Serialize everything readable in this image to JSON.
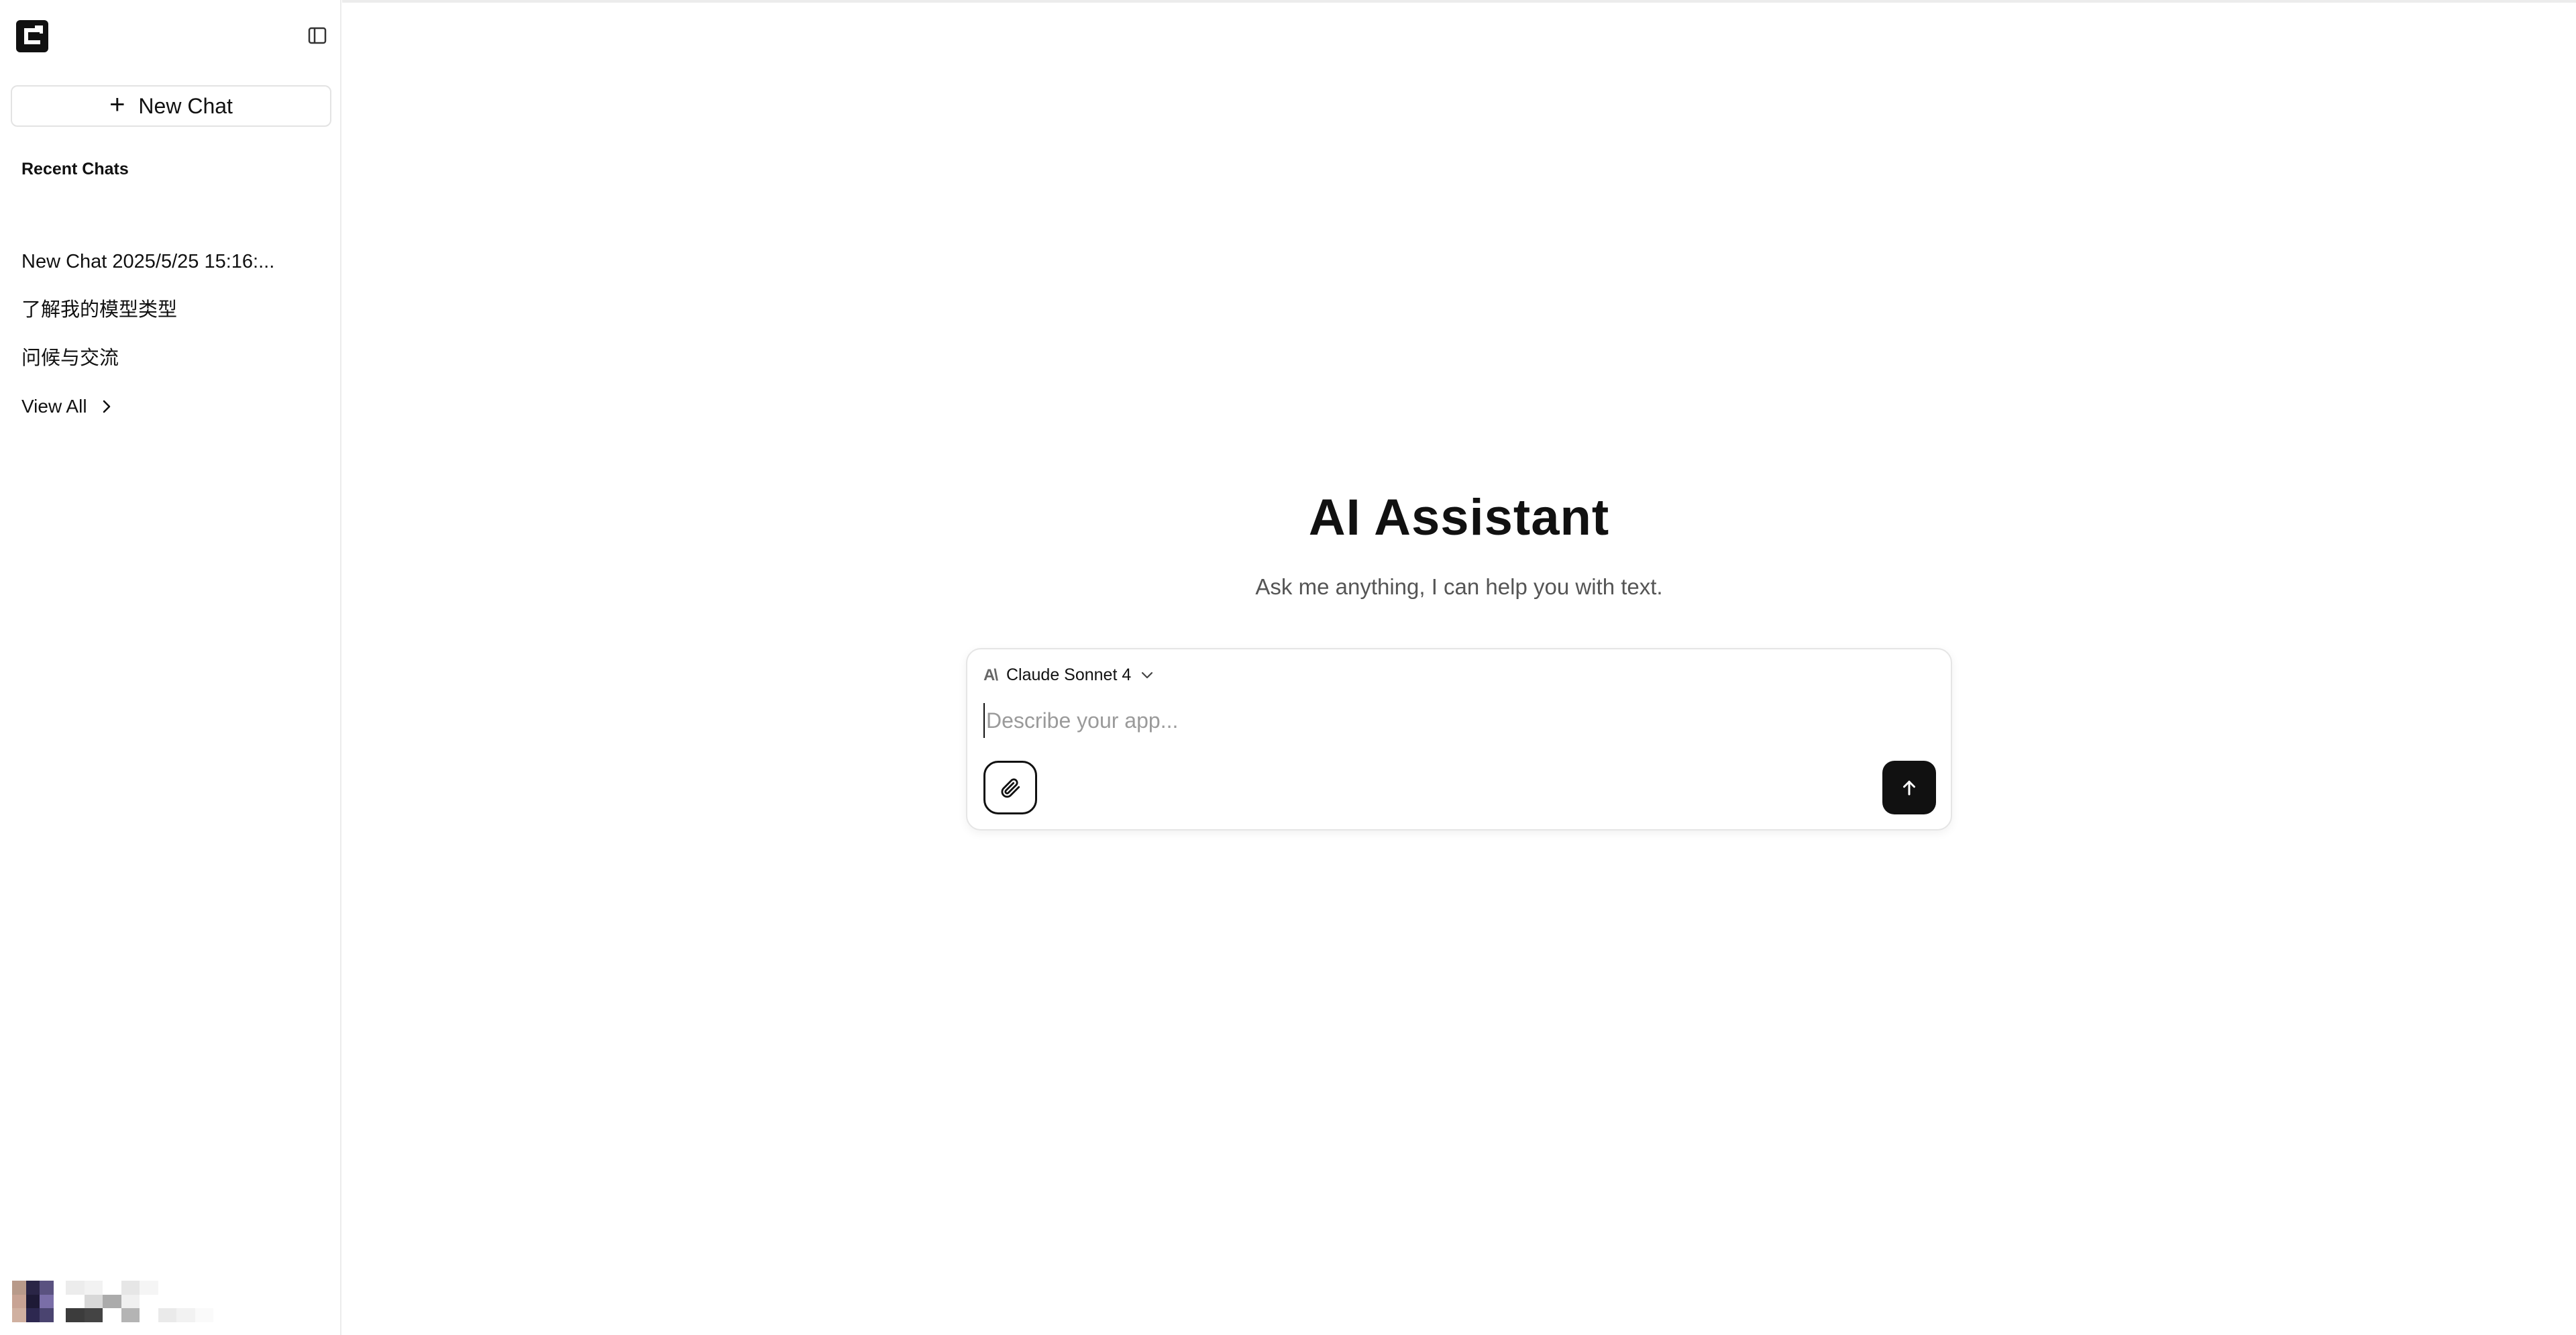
{
  "app": {
    "title": "AI Assistant",
    "subtitle": "Ask me anything, I can help you with text."
  },
  "sidebar": {
    "new_chat_label": "New Chat",
    "recent_title": "Recent Chats",
    "chats": [
      {
        "label": "New Chat 2025/5/25 15:16:..."
      },
      {
        "label": "了解我的模型类型"
      },
      {
        "label": "问候与交流"
      }
    ],
    "view_all_label": "View All",
    "icons": {
      "logo": "app-logo-icon",
      "collapse": "sidebar-toggle-icon",
      "plus": "plus-icon",
      "view_all": "chevron-right-icon"
    }
  },
  "composer": {
    "model_name": "Claude Sonnet 4",
    "placeholder": "Describe your app...",
    "value": "",
    "icons": {
      "model": "anthropic-icon",
      "dropdown": "chevron-down-icon",
      "attach": "paperclip-icon",
      "send": "arrow-up-icon"
    }
  },
  "colors": {
    "accent": "#111111",
    "border": "#e5e5e5",
    "muted_text": "#555555",
    "placeholder": "#9a9a9a"
  }
}
